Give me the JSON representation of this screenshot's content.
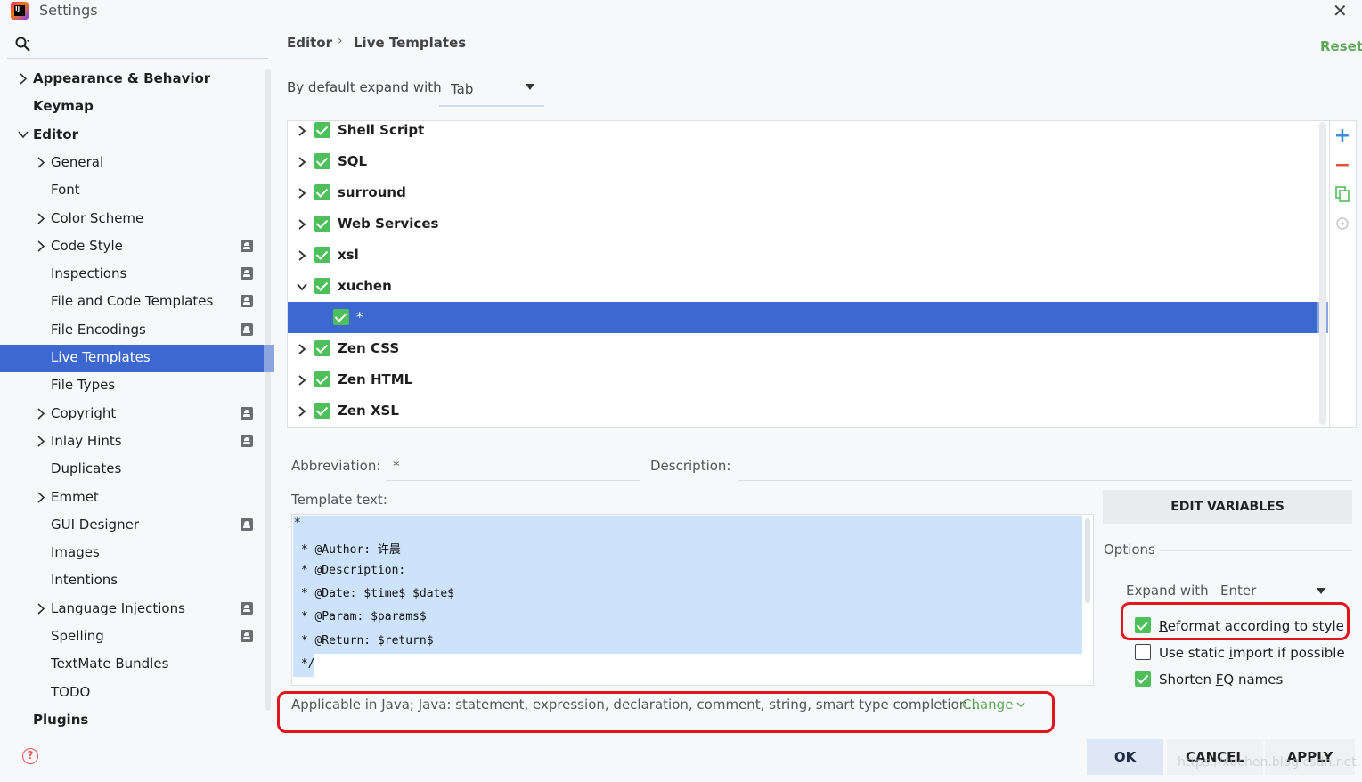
{
  "window": {
    "title": "Settings"
  },
  "sidebar": {
    "items": [
      {
        "label": "Appearance & Behavior",
        "bold": true,
        "expandable": true,
        "expanded": false,
        "level": 0,
        "badge": false
      },
      {
        "label": "Keymap",
        "bold": true,
        "expandable": false,
        "level": 0,
        "badge": false
      },
      {
        "label": "Editor",
        "bold": true,
        "expandable": true,
        "expanded": true,
        "level": 0,
        "badge": false
      },
      {
        "label": "General",
        "expandable": true,
        "level": 1,
        "badge": false
      },
      {
        "label": "Font",
        "expandable": false,
        "level": 1,
        "badge": false
      },
      {
        "label": "Color Scheme",
        "expandable": true,
        "level": 1,
        "badge": false
      },
      {
        "label": "Code Style",
        "expandable": true,
        "level": 1,
        "badge": true
      },
      {
        "label": "Inspections",
        "expandable": false,
        "level": 1,
        "badge": true
      },
      {
        "label": "File and Code Templates",
        "expandable": false,
        "level": 1,
        "badge": true
      },
      {
        "label": "File Encodings",
        "expandable": false,
        "level": 1,
        "badge": true
      },
      {
        "label": "Live Templates",
        "expandable": false,
        "level": 1,
        "badge": false,
        "selected": true
      },
      {
        "label": "File Types",
        "expandable": false,
        "level": 1,
        "badge": false
      },
      {
        "label": "Copyright",
        "expandable": true,
        "level": 1,
        "badge": true
      },
      {
        "label": "Inlay Hints",
        "expandable": true,
        "level": 1,
        "badge": true
      },
      {
        "label": "Duplicates",
        "expandable": false,
        "level": 1,
        "badge": false
      },
      {
        "label": "Emmet",
        "expandable": true,
        "level": 1,
        "badge": false
      },
      {
        "label": "GUI Designer",
        "expandable": false,
        "level": 1,
        "badge": true
      },
      {
        "label": "Images",
        "expandable": false,
        "level": 1,
        "badge": false
      },
      {
        "label": "Intentions",
        "expandable": false,
        "level": 1,
        "badge": false
      },
      {
        "label": "Language Injections",
        "expandable": true,
        "level": 1,
        "badge": true
      },
      {
        "label": "Spelling",
        "expandable": false,
        "level": 1,
        "badge": true
      },
      {
        "label": "TextMate Bundles",
        "expandable": false,
        "level": 1,
        "badge": false
      },
      {
        "label": "TODO",
        "expandable": false,
        "level": 1,
        "badge": false
      },
      {
        "label": "Plugins",
        "bold": true,
        "expandable": false,
        "level": 0,
        "badge": false
      }
    ]
  },
  "header": {
    "breadcrumb_editor": "Editor",
    "breadcrumb_sep": "›",
    "breadcrumb_live": "Live Templates",
    "reset": "Reset"
  },
  "expand": {
    "label": "By default expand with",
    "value": "Tab"
  },
  "templates": {
    "groups": [
      {
        "label": "Shell Script",
        "expanded": false
      },
      {
        "label": "SQL",
        "expanded": false
      },
      {
        "label": "surround",
        "expanded": false
      },
      {
        "label": "Web Services",
        "expanded": false
      },
      {
        "label": "xsl",
        "expanded": false
      },
      {
        "label": "xuchen",
        "expanded": true
      },
      {
        "label": "*",
        "child": true,
        "selected": true
      },
      {
        "label": "Zen CSS",
        "expanded": false
      },
      {
        "label": "Zen HTML",
        "expanded": false
      },
      {
        "label": "Zen XSL",
        "expanded": false
      }
    ]
  },
  "detail": {
    "abbreviation_label": "Abbreviation:",
    "abbreviation_value": "*",
    "description_label": "Description:",
    "template_label": "Template text:",
    "template_lines": [
      "*",
      " * @Author: 许晨",
      " * @Description:",
      " * @Date: $time$ $date$",
      " * @Param: $params$",
      " * @Return: $return$",
      " */"
    ],
    "applicable": "Applicable in Java; Java: statement, expression, declaration, comment, string, smart type completion...",
    "change": "Change"
  },
  "options": {
    "edit_variables": "EDIT VARIABLES",
    "title": "Options",
    "expand_with_label": "Expand with",
    "expand_with_value": "Enter",
    "reformat_pre": "",
    "reformat_ul": "R",
    "reformat_post": "eformat according to style",
    "static_pre": "Use static ",
    "static_ul": "i",
    "static_post": "mport if possible",
    "shorten_pre": "Shorten ",
    "shorten_ul": "F",
    "shorten_post": "Q names",
    "reformat_checked": true,
    "static_checked": false,
    "shorten_checked": true
  },
  "buttons": {
    "ok": "OK",
    "cancel": "CANCEL",
    "apply": "APPLY"
  },
  "watermark": "https://xuchen.blog.csdn.net",
  "colors": {
    "selection": "#3d68cf",
    "check": "#4fbf5b",
    "link": "#5fa85b",
    "highlight_box": "#e0161e"
  }
}
